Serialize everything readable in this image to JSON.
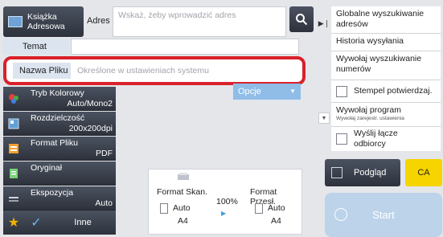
{
  "address_book": {
    "label": "Książka Adresowa"
  },
  "address": {
    "label": "Adres",
    "placeholder": "Wskaż, żeby wprowadzić adres"
  },
  "fields": {
    "subject_label": "Temat",
    "filename_label": "Nazwa Pliku",
    "filename_value": "Określone w ustawieniach systemu",
    "options_label": "Opcje"
  },
  "side_menu": {
    "items": [
      "Globalne wyszukiwanie adresów",
      "Historia wysyłania",
      "Wywołaj wyszukiwanie numerów",
      "Stempel potwierdzaj.",
      "Wywołaj program",
      "Wywołaj zarejestr. ustawienia",
      "Wyślij łącze odbiorcy"
    ]
  },
  "settings": [
    {
      "label": "Tryb Kolorowy",
      "value": "Auto/Mono2"
    },
    {
      "label": "Rozdzielczość",
      "value": "200x200dpi"
    },
    {
      "label": "Format Pliku",
      "value": "PDF"
    },
    {
      "label": "Oryginał",
      "value": ""
    },
    {
      "label": "Ekspozycja",
      "value": "Auto"
    }
  ],
  "footer": {
    "other_label": "Inne"
  },
  "scan": {
    "scan_size_label": "Format Skan.",
    "send_size_label": "Format Przesł.",
    "ratio": "100%",
    "scan_auto": "Auto",
    "send_auto": "Auto",
    "scan_paper": "A4",
    "send_paper": "A4"
  },
  "actions": {
    "preview_label": "Podgląd",
    "ca_label": "CA",
    "start_label": "Start"
  },
  "colors": {
    "accent_red": "#d9212b",
    "ca_yellow": "#f5d400",
    "options_blue": "#8fbde8"
  }
}
